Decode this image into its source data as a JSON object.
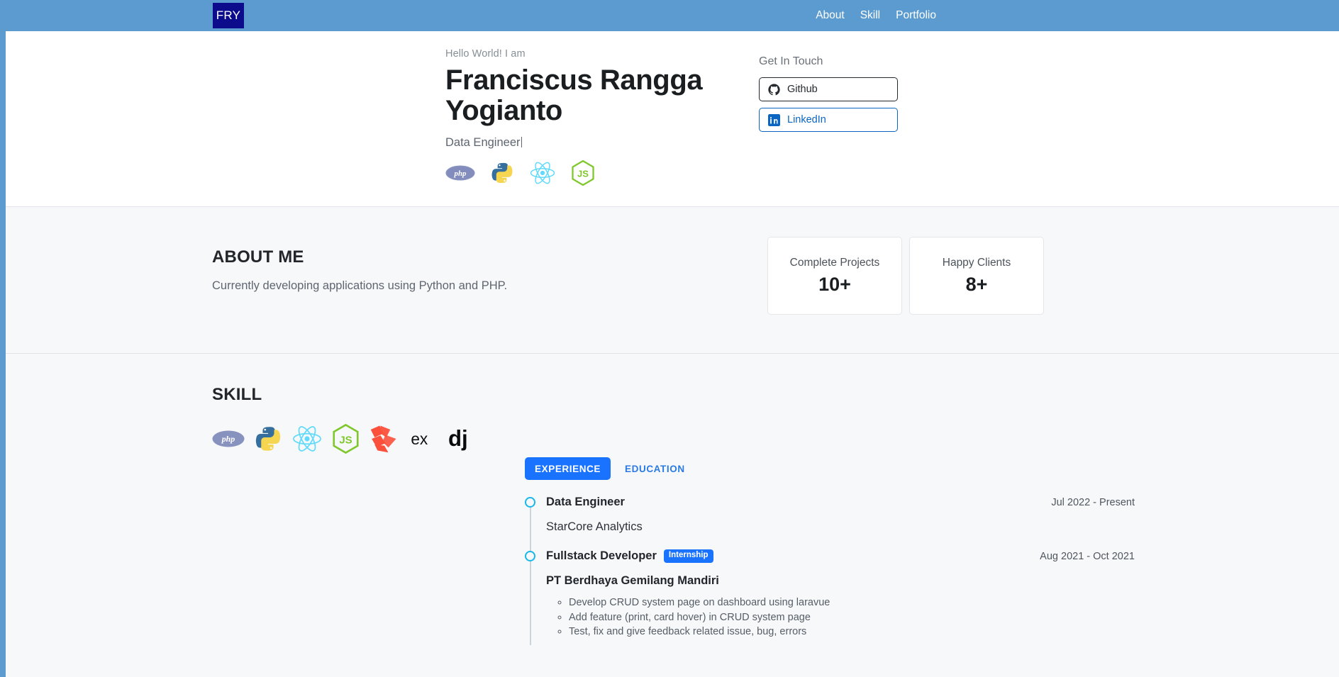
{
  "navbar": {
    "brand": "FRY",
    "links": [
      {
        "label": "About",
        "name": "nav-link-about"
      },
      {
        "label": "Skill",
        "name": "nav-link-skill"
      },
      {
        "label": "Portfolio",
        "name": "nav-link-portfolio"
      }
    ],
    "background_color": "#5b9bd0",
    "brand_background_color": "#0b0b8c"
  },
  "hero": {
    "greeting": "Hello World! I am",
    "name": "Franciscus Rangga Yogianto",
    "role": "Data Engineer",
    "tech_icons": [
      "php-icon",
      "python-icon",
      "react-icon",
      "nodejs-icon"
    ],
    "contact": {
      "title": "Get In Touch",
      "buttons": [
        {
          "label": "Github",
          "icon": "github-icon",
          "color": "#24292e"
        },
        {
          "label": "LinkedIn",
          "icon": "linkedin-icon",
          "color": "#0a66c2"
        }
      ]
    }
  },
  "about": {
    "title": "ABOUT ME",
    "description": "Currently developing applications using Python and PHP.",
    "stats": [
      {
        "label": "Complete Projects",
        "value": "10+"
      },
      {
        "label": "Happy Clients",
        "value": "8+"
      }
    ]
  },
  "skill": {
    "title": "SKILL",
    "icons": [
      "php-icon",
      "python-icon",
      "react-icon",
      "nodejs-icon",
      "laravel-icon",
      "express-icon",
      "django-icon"
    ],
    "tabs": [
      {
        "label": "EXPERIENCE",
        "active": true
      },
      {
        "label": "EDUCATION",
        "active": false
      }
    ],
    "timeline": [
      {
        "role": "Data Engineer",
        "badge": null,
        "date": "Jul 2022 - Present",
        "company": "StarCore Analytics",
        "company_bold": false,
        "bullets": []
      },
      {
        "role": "Fullstack Developer",
        "badge": "Internship",
        "date": "Aug 2021 - Oct 2021",
        "company": "PT Berdhaya Gemilang Mandiri",
        "company_bold": true,
        "bullets": [
          "Develop CRUD system page on dashboard using laravue",
          "Add feature (print, card hover) in CRUD system page",
          "Test, fix and give feedback related issue, bug, errors"
        ]
      }
    ]
  },
  "colors": {
    "accent_blue": "#1a73ff",
    "nav_blue": "#5b9bd0",
    "timeline_dot": "#16b8e8",
    "section_bg": "#f7f8fa"
  }
}
